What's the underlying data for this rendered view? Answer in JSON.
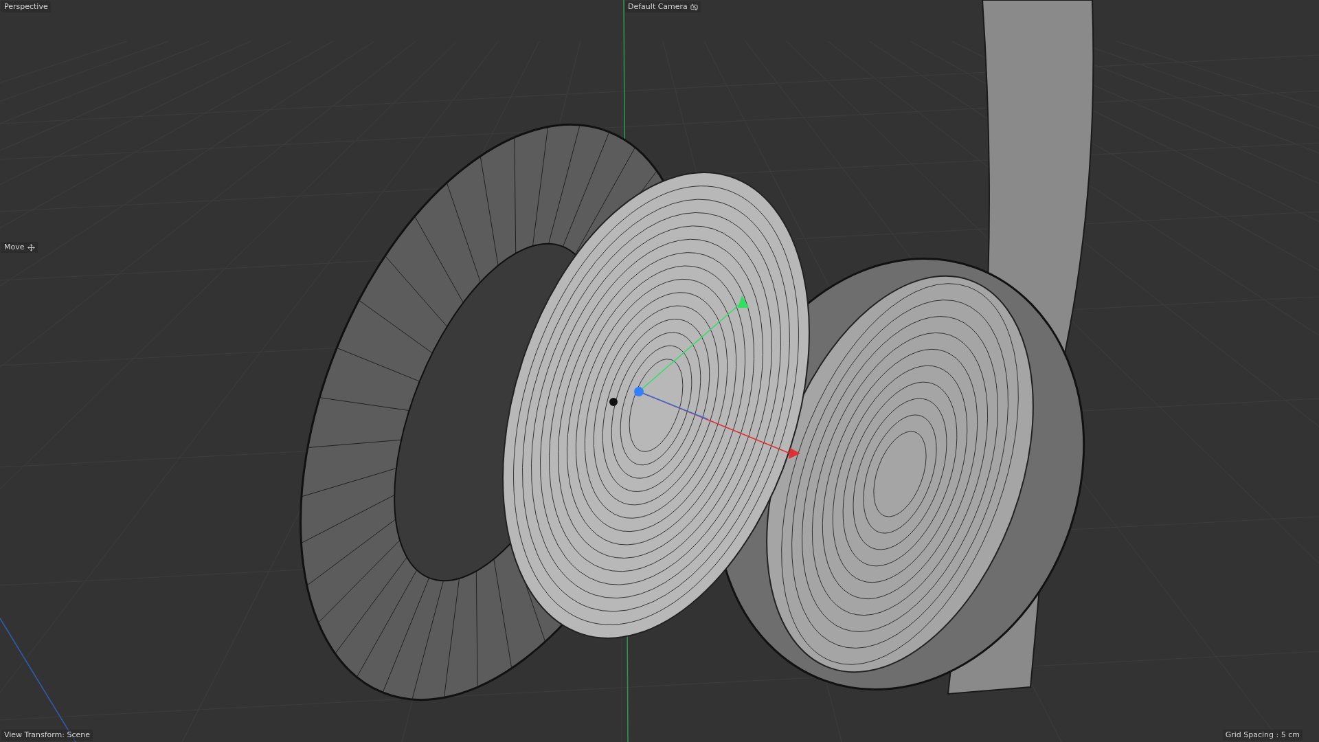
{
  "viewport": {
    "view_name": "Perspective",
    "camera": "Default Camera",
    "tool": "Move",
    "view_transform": "View Transform: Scene",
    "grid_spacing": "Grid Spacing : 5 cm"
  }
}
